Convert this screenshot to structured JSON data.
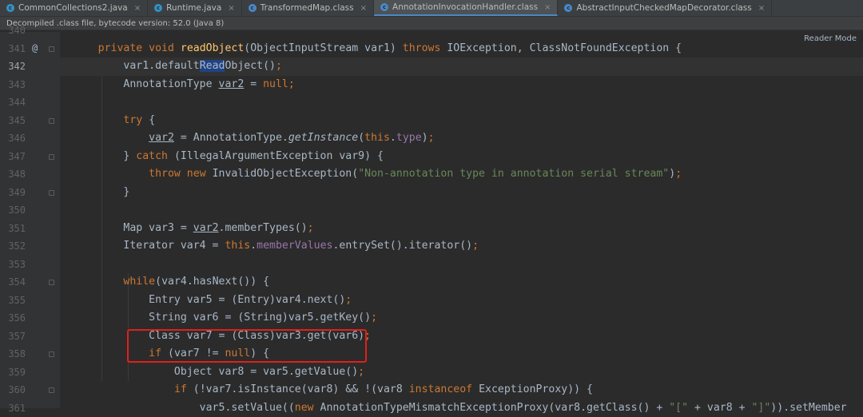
{
  "tabs": [
    {
      "label": "CommonCollections2.java",
      "icon": "java-class-icon",
      "active": false
    },
    {
      "label": "Runtime.java",
      "icon": "java-class-icon",
      "active": false
    },
    {
      "label": "TransformedMap.class",
      "icon": "java-class-icon",
      "active": false
    },
    {
      "label": "AnnotationInvocationHandler.class",
      "icon": "java-class-icon",
      "active": true
    },
    {
      "label": "AbstractInputCheckedMapDecorator.class",
      "icon": "java-class-icon",
      "active": false
    }
  ],
  "banner": {
    "text": "Decompiled .class file, bytecode version: 52.0 (Java 8)"
  },
  "reader_mode": "Reader Mode",
  "lines": [
    {
      "n": "340",
      "tokens": []
    },
    {
      "n": "341",
      "tokens": [
        {
          "t": "    "
        },
        {
          "t": "private void ",
          "c": "kw"
        },
        {
          "t": "readObject",
          "c": "fn"
        },
        {
          "t": "(ObjectInputStream var1) "
        },
        {
          "t": "throws ",
          "c": "kw"
        },
        {
          "t": "IOException, ClassNotFoundException {"
        }
      ]
    },
    {
      "n": "342",
      "tokens": [
        {
          "t": "        var1.default"
        },
        {
          "t": "Read",
          "c": "sel"
        },
        {
          "t": "Object()"
        },
        {
          "t": ";",
          "c": "kw"
        }
      ]
    },
    {
      "n": "343",
      "tokens": [
        {
          "t": "        AnnotationType "
        },
        {
          "t": "var2",
          "c": "ul"
        },
        {
          "t": " = "
        },
        {
          "t": "null",
          "c": "kw"
        },
        {
          "t": ";",
          "c": "kw"
        }
      ]
    },
    {
      "n": "344",
      "tokens": []
    },
    {
      "n": "345",
      "tokens": [
        {
          "t": "        "
        },
        {
          "t": "try ",
          "c": "kw"
        },
        {
          "t": "{"
        }
      ]
    },
    {
      "n": "346",
      "tokens": [
        {
          "t": "            "
        },
        {
          "t": "var2",
          "c": "ul"
        },
        {
          "t": " = AnnotationType."
        },
        {
          "t": "getInstance",
          "c": "it"
        },
        {
          "t": "("
        },
        {
          "t": "this",
          "c": "kw"
        },
        {
          "t": "."
        },
        {
          "t": "type",
          "c": "fld"
        },
        {
          "t": ")"
        },
        {
          "t": ";",
          "c": "kw"
        }
      ]
    },
    {
      "n": "347",
      "tokens": [
        {
          "t": "        } "
        },
        {
          "t": "catch ",
          "c": "kw"
        },
        {
          "t": "(IllegalArgumentException var9) {"
        }
      ]
    },
    {
      "n": "348",
      "tokens": [
        {
          "t": "            "
        },
        {
          "t": "throw new ",
          "c": "kw"
        },
        {
          "t": "InvalidObjectException("
        },
        {
          "t": "\"Non-annotation type in annotation serial stream\"",
          "c": "str"
        },
        {
          "t": ")"
        },
        {
          "t": ";",
          "c": "kw"
        }
      ]
    },
    {
      "n": "349",
      "tokens": [
        {
          "t": "        }"
        }
      ]
    },
    {
      "n": "350",
      "tokens": []
    },
    {
      "n": "351",
      "tokens": [
        {
          "t": "        Map var3 = "
        },
        {
          "t": "var2",
          "c": "ul"
        },
        {
          "t": ".memberTypes()"
        },
        {
          "t": ";",
          "c": "kw"
        }
      ]
    },
    {
      "n": "352",
      "tokens": [
        {
          "t": "        Iterator var4 = "
        },
        {
          "t": "this",
          "c": "kw"
        },
        {
          "t": "."
        },
        {
          "t": "memberValues",
          "c": "fld"
        },
        {
          "t": ".entrySet().iterator()"
        },
        {
          "t": ";",
          "c": "kw"
        }
      ]
    },
    {
      "n": "353",
      "tokens": []
    },
    {
      "n": "354",
      "tokens": [
        {
          "t": "        "
        },
        {
          "t": "while",
          "c": "kw"
        },
        {
          "t": "(var4.hasNext()) {"
        }
      ]
    },
    {
      "n": "355",
      "tokens": [
        {
          "t": "            Entry var5 = (Entry)var4.next()"
        },
        {
          "t": ";",
          "c": "kw"
        }
      ]
    },
    {
      "n": "356",
      "tokens": [
        {
          "t": "            String var6 = (String)var5.getKey()"
        },
        {
          "t": ";",
          "c": "kw"
        }
      ]
    },
    {
      "n": "357",
      "tokens": [
        {
          "t": "            Class var7 = (Class)var3.get(var6)"
        },
        {
          "t": ";",
          "c": "kw"
        }
      ]
    },
    {
      "n": "358",
      "tokens": [
        {
          "t": "            "
        },
        {
          "t": "if ",
          "c": "kw"
        },
        {
          "t": "(var7 != "
        },
        {
          "t": "null",
          "c": "kw"
        },
        {
          "t": ") {"
        }
      ]
    },
    {
      "n": "359",
      "tokens": [
        {
          "t": "                Object var8 = var5.getValue()"
        },
        {
          "t": ";",
          "c": "kw"
        }
      ]
    },
    {
      "n": "360",
      "tokens": [
        {
          "t": "                "
        },
        {
          "t": "if ",
          "c": "kw"
        },
        {
          "t": "(!var7.isInstance(var8) && !(var8 "
        },
        {
          "t": "instanceof ",
          "c": "kw"
        },
        {
          "t": "ExceptionProxy)) {"
        }
      ]
    },
    {
      "n": "361",
      "tokens": [
        {
          "t": "                    var5.setValue(("
        },
        {
          "t": "new ",
          "c": "kw"
        },
        {
          "t": "AnnotationTypeMismatchExceptionProxy(var8.getClass() + "
        },
        {
          "t": "\"[\"",
          "c": "str"
        },
        {
          "t": " + var8 + "
        },
        {
          "t": "\"]\"",
          "c": "str"
        },
        {
          "t": ")).setMember"
        }
      ]
    }
  ],
  "current_line": "342",
  "gutter_marks": {
    "341": "@"
  },
  "fold_lines": [
    "341",
    "345",
    "347",
    "349",
    "354",
    "358",
    "360"
  ]
}
